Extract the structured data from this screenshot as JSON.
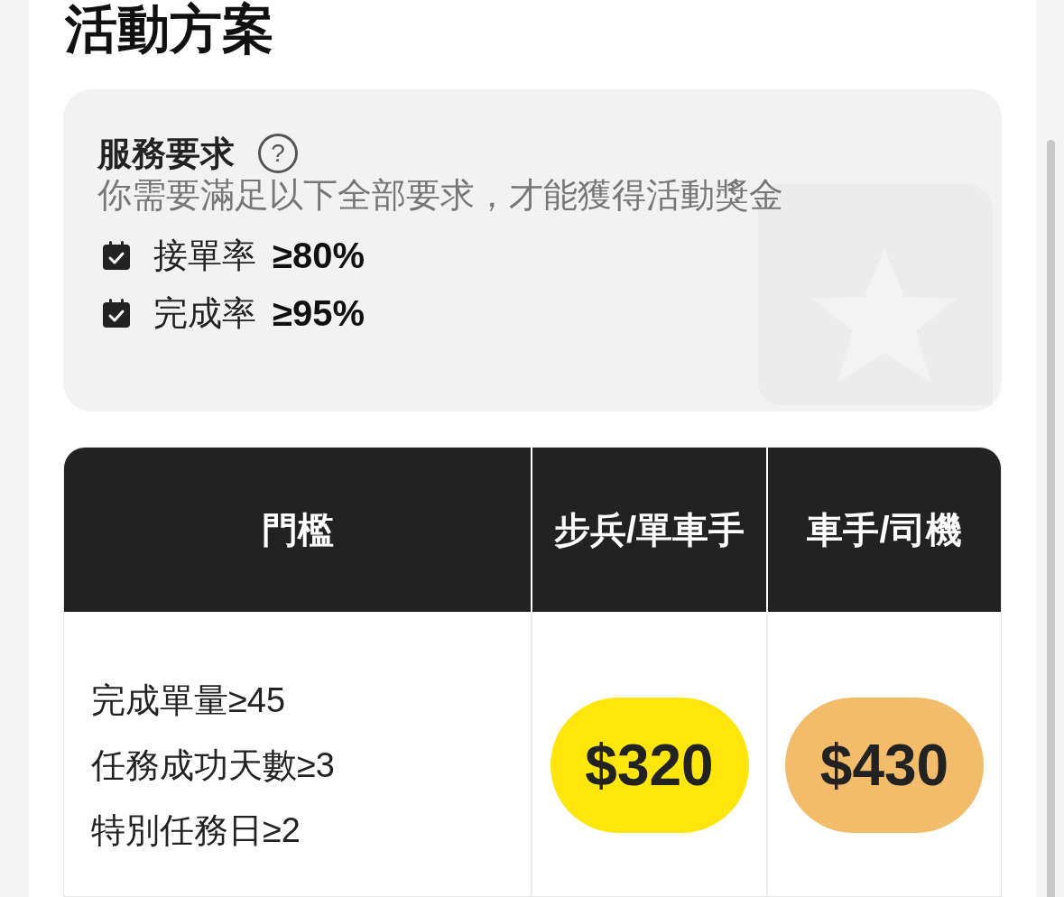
{
  "title": "活動方案",
  "requirements": {
    "title": "服務要求",
    "help": "?",
    "subtitle": "你需要滿足以下全部要求，才能獲得活動獎金",
    "items": [
      {
        "label": "接單率",
        "value": "≥80%"
      },
      {
        "label": "完成率",
        "value": "≥95%"
      }
    ]
  },
  "table": {
    "columns": [
      "門檻",
      "步兵/單車手",
      "車手/司機"
    ],
    "rows": [
      {
        "conditions": [
          "完成單量≥45",
          "任務成功天數≥3",
          "特別任務日≥2"
        ],
        "prices": [
          {
            "text": "$320",
            "color": "#ffe60a"
          },
          {
            "text": "$430",
            "color": "#f2bc6b"
          }
        ]
      }
    ]
  }
}
